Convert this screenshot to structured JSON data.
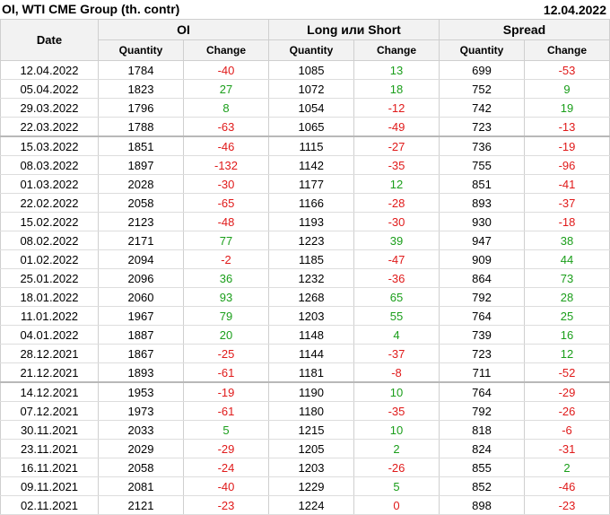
{
  "header": {
    "title": "OI, WTI CME Group (th. contr)",
    "date": "12.04.2022"
  },
  "columns": {
    "date": "Date",
    "groups": [
      "OI",
      "Long или Short",
      "Spread"
    ],
    "quantity": "Quantity",
    "change": "Change"
  },
  "colors": {
    "positive": "#1a9e1a",
    "negative": "#e01a1a"
  },
  "rows": [
    {
      "date": "12.04.2022",
      "oi_q": "1784",
      "oi_c": "-40",
      "ls_q": "1085",
      "ls_c": "13",
      "sp_q": "699",
      "sp_c": "-53"
    },
    {
      "date": "05.04.2022",
      "oi_q": "1823",
      "oi_c": "27",
      "ls_q": "1072",
      "ls_c": "18",
      "sp_q": "752",
      "sp_c": "9"
    },
    {
      "date": "29.03.2022",
      "oi_q": "1796",
      "oi_c": "8",
      "ls_q": "1054",
      "ls_c": "-12",
      "sp_q": "742",
      "sp_c": "19"
    },
    {
      "date": "22.03.2022",
      "oi_q": "1788",
      "oi_c": "-63",
      "ls_q": "1065",
      "ls_c": "-49",
      "sp_q": "723",
      "sp_c": "-13"
    },
    {
      "date": "15.03.2022",
      "oi_q": "1851",
      "oi_c": "-46",
      "ls_q": "1115",
      "ls_c": "-27",
      "sp_q": "736",
      "sp_c": "-19"
    },
    {
      "date": "08.03.2022",
      "oi_q": "1897",
      "oi_c": "-132",
      "ls_q": "1142",
      "ls_c": "-35",
      "sp_q": "755",
      "sp_c": "-96"
    },
    {
      "date": "01.03.2022",
      "oi_q": "2028",
      "oi_c": "-30",
      "ls_q": "1177",
      "ls_c": "12",
      "sp_q": "851",
      "sp_c": "-41"
    },
    {
      "date": "22.02.2022",
      "oi_q": "2058",
      "oi_c": "-65",
      "ls_q": "1166",
      "ls_c": "-28",
      "sp_q": "893",
      "sp_c": "-37"
    },
    {
      "date": "15.02.2022",
      "oi_q": "2123",
      "oi_c": "-48",
      "ls_q": "1193",
      "ls_c": "-30",
      "sp_q": "930",
      "sp_c": "-18"
    },
    {
      "date": "08.02.2022",
      "oi_q": "2171",
      "oi_c": "77",
      "ls_q": "1223",
      "ls_c": "39",
      "sp_q": "947",
      "sp_c": "38"
    },
    {
      "date": "01.02.2022",
      "oi_q": "2094",
      "oi_c": "-2",
      "ls_q": "1185",
      "ls_c": "-47",
      "sp_q": "909",
      "sp_c": "44"
    },
    {
      "date": "25.01.2022",
      "oi_q": "2096",
      "oi_c": "36",
      "ls_q": "1232",
      "ls_c": "-36",
      "sp_q": "864",
      "sp_c": "73"
    },
    {
      "date": "18.01.2022",
      "oi_q": "2060",
      "oi_c": "93",
      "ls_q": "1268",
      "ls_c": "65",
      "sp_q": "792",
      "sp_c": "28"
    },
    {
      "date": "11.01.2022",
      "oi_q": "1967",
      "oi_c": "79",
      "ls_q": "1203",
      "ls_c": "55",
      "sp_q": "764",
      "sp_c": "25"
    },
    {
      "date": "04.01.2022",
      "oi_q": "1887",
      "oi_c": "20",
      "ls_q": "1148",
      "ls_c": "4",
      "sp_q": "739",
      "sp_c": "16"
    },
    {
      "date": "28.12.2021",
      "oi_q": "1867",
      "oi_c": "-25",
      "ls_q": "1144",
      "ls_c": "-37",
      "sp_q": "723",
      "sp_c": "12"
    },
    {
      "date": "21.12.2021",
      "oi_q": "1893",
      "oi_c": "-61",
      "ls_q": "1181",
      "ls_c": "-8",
      "sp_q": "711",
      "sp_c": "-52"
    },
    {
      "date": "14.12.2021",
      "oi_q": "1953",
      "oi_c": "-19",
      "ls_q": "1190",
      "ls_c": "10",
      "sp_q": "764",
      "sp_c": "-29"
    },
    {
      "date": "07.12.2021",
      "oi_q": "1973",
      "oi_c": "-61",
      "ls_q": "1180",
      "ls_c": "-35",
      "sp_q": "792",
      "sp_c": "-26"
    },
    {
      "date": "30.11.2021",
      "oi_q": "2033",
      "oi_c": "5",
      "ls_q": "1215",
      "ls_c": "10",
      "sp_q": "818",
      "sp_c": "-6"
    },
    {
      "date": "23.11.2021",
      "oi_q": "2029",
      "oi_c": "-29",
      "ls_q": "1205",
      "ls_c": "2",
      "sp_q": "824",
      "sp_c": "-31"
    },
    {
      "date": "16.11.2021",
      "oi_q": "2058",
      "oi_c": "-24",
      "ls_q": "1203",
      "ls_c": "-26",
      "sp_q": "855",
      "sp_c": "2"
    },
    {
      "date": "09.11.2021",
      "oi_q": "2081",
      "oi_c": "-40",
      "ls_q": "1229",
      "ls_c": "5",
      "sp_q": "852",
      "sp_c": "-46"
    },
    {
      "date": "02.11.2021",
      "oi_q": "2121",
      "oi_c": "-23",
      "ls_q": "1224",
      "ls_c": "0",
      "sp_q": "898",
      "sp_c": "-23"
    }
  ]
}
